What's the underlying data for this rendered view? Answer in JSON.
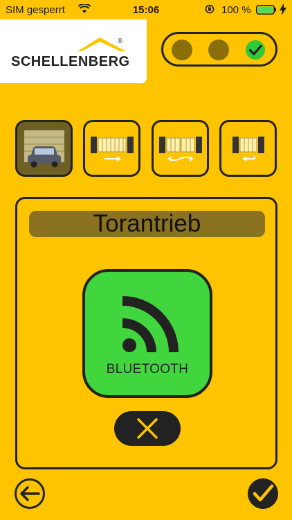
{
  "status_bar": {
    "carrier": "SIM gesperrt",
    "time": "15:06",
    "battery_percent": "100 %",
    "icons": [
      "wifi-icon",
      "orientation-lock-icon",
      "battery-icon",
      "charging-icon"
    ]
  },
  "brand": {
    "name": "SCHELLENBERG",
    "registered_mark": "®"
  },
  "status_indicators": [
    {
      "state": "inactive",
      "icon": "dot-icon"
    },
    {
      "state": "inactive",
      "icon": "dot-icon"
    },
    {
      "state": "ok",
      "icon": "check-icon"
    }
  ],
  "modes": [
    {
      "id": "torantrieb",
      "icon": "garage-car-icon",
      "active": true
    },
    {
      "id": "single-gate",
      "icon": "gate-slide-icon",
      "active": false
    },
    {
      "id": "double-gate",
      "icon": "gate-double-icon",
      "active": false
    },
    {
      "id": "small-gate",
      "icon": "gate-small-icon",
      "active": false
    }
  ],
  "panel": {
    "title": "Torantrieb",
    "bluetooth_label": "BLUETOOTH"
  },
  "navigation": {
    "back_icon": "arrow-left-icon",
    "confirm_icon": "check-icon",
    "cancel_icon": "close-icon"
  },
  "colors": {
    "background": "#FFC400",
    "active_mode": "#6e5f24",
    "title_bar": "#8a7220",
    "bluetooth_green": "#41d63d",
    "status_ok_green": "#31c83a",
    "dark": "#222222"
  }
}
